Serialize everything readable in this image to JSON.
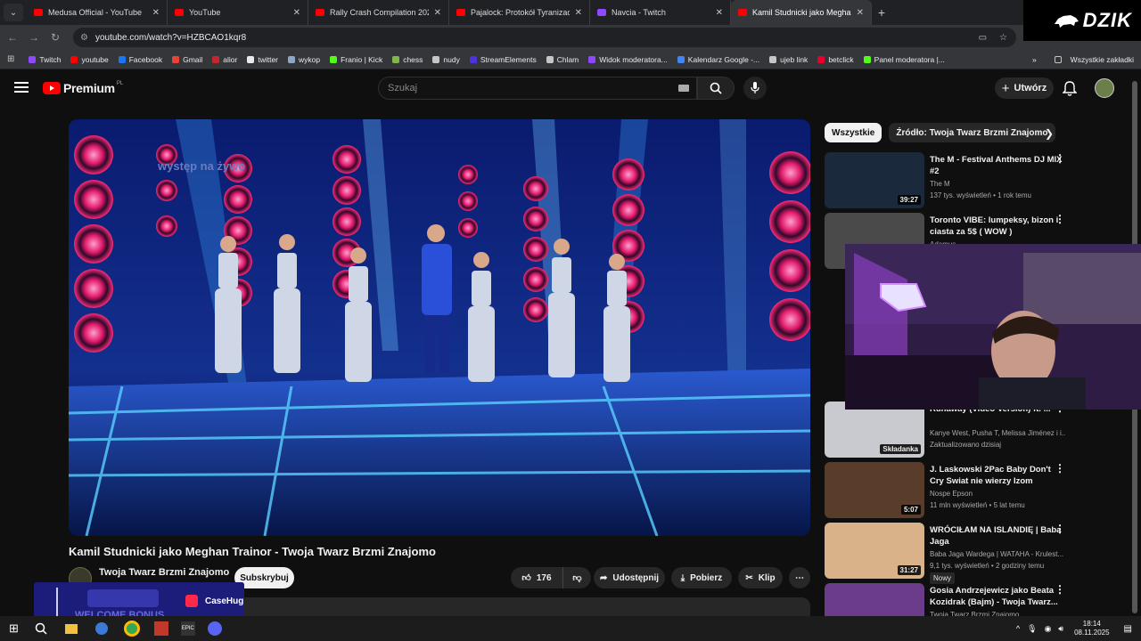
{
  "browser": {
    "tabs": [
      {
        "title": "Medusa Official - YouTube",
        "type": "yt"
      },
      {
        "title": "YouTube",
        "type": "yt"
      },
      {
        "title": "Rally Crash Compilation 2022 b",
        "type": "yt"
      },
      {
        "title": "Pajalock: Protokół Tyranizacja -",
        "type": "yt"
      },
      {
        "title": "Navcia - Twitch",
        "type": "tw"
      },
      {
        "title": "Kamil Studnicki jako Meghan Tr",
        "type": "yt"
      }
    ],
    "new_tab": "+",
    "url": "youtube.com/watch?v=HZBCAO1kqr8",
    "overlay_logo": "DZIK",
    "bookmarks": [
      {
        "label": "Twitch",
        "color": "#9146ff"
      },
      {
        "label": "youtube",
        "color": "#ff0000"
      },
      {
        "label": "Facebook",
        "color": "#1877f2"
      },
      {
        "label": "Gmail",
        "color": "#ea4335"
      },
      {
        "label": "alior",
        "color": "#c4262e"
      },
      {
        "label": "twitter",
        "color": "#e8eaed"
      },
      {
        "label": "wykop",
        "color": "#8fa6c7"
      },
      {
        "label": "Franio | Kick",
        "color": "#53fc18"
      },
      {
        "label": "chess",
        "color": "#81b64c"
      },
      {
        "label": "nudy",
        "color": "#c4c7c5"
      },
      {
        "label": "StreamElements",
        "color": "#4b33e0"
      },
      {
        "label": "Chlam",
        "color": "#c4c7c5"
      },
      {
        "label": "Widok moderatora...",
        "color": "#9146ff"
      },
      {
        "label": "Kalendarz Google -...",
        "color": "#4285f4"
      },
      {
        "label": "ujeb link",
        "color": "#c4c7c5"
      },
      {
        "label": "betclick",
        "color": "#e8002d"
      },
      {
        "label": "Panel moderatora |...",
        "color": "#53fc18"
      }
    ],
    "more_bookmarks": "»",
    "all_bookmarks": "Wszystkie zakładki"
  },
  "youtube": {
    "logo_text": "Premium",
    "logo_region": "PL",
    "search_placeholder": "Szukaj",
    "create_label": "Utwórz",
    "video": {
      "watermark": "występ na żywo",
      "title": "Kamil Studnicki jako Meghan Trainor - Twoja Twarz Brzmi Znajomo",
      "channel": "Twoja Twarz Brzmi Znajomo",
      "subscribe": "Subskrybuj",
      "likes": "176",
      "share": "Udostępnij",
      "download": "Pobierz",
      "clip": "Klip"
    },
    "chips": [
      "Wszystkie",
      "Źródło: Twoja Twarz Brzmi Znajomo"
    ],
    "recommendations": [
      {
        "title": "The M - Festival Anthems DJ MIX #2",
        "channel": "The M",
        "meta": "137 tys. wyświetleń • 1 rok temu",
        "duration": "39:27",
        "thumb": "#1a2a3c"
      },
      {
        "title": "Toronto VIBE: lumpeksy, bizon i ciasta za 5$ ( WOW )",
        "channel": "Adamus",
        "meta": "",
        "duration": "",
        "thumb": "#4a4a4a"
      },
      {
        "title": "Runaway (Video Version) ft. ...",
        "channel": "Kanye West, Pusha T, Melissa Jiménez i i...",
        "meta": "Zaktualizowano dzisiaj",
        "duration": "Składanka",
        "thumb": "#c9c9d0"
      },
      {
        "title": "J. Laskowski  2Pac Baby Don't Cry Swiat nie wierzy Izom",
        "channel": "Nospe Epson",
        "meta": "11 mln wyświetleń • 5 lat temu",
        "duration": "5:07",
        "thumb": "#5a3c2a"
      },
      {
        "title": "WRÓCIŁAM NA ISLANDIĘ | Baba Jaga",
        "channel": "Baba Jaga Wardega | WATAHA - Krulest...",
        "meta": "9,1 tys. wyświetleń • 2 godziny temu",
        "duration": "31:27",
        "badge": "Nowy",
        "thumb": "#d9b28a"
      },
      {
        "title": "Gosia Andrzejewicz jako Beata Kozidrak (Bajm) - Twoja Twarz...",
        "channel": "Twoja Twarz Brzmi Znajomo",
        "meta": "",
        "duration": "",
        "thumb": "#6a3c8a"
      }
    ]
  },
  "ad": {
    "brand": "CaseHug",
    "text": "WELCOME BONUS"
  },
  "taskbar": {
    "time": "18:14",
    "date": "08.11.2025"
  }
}
